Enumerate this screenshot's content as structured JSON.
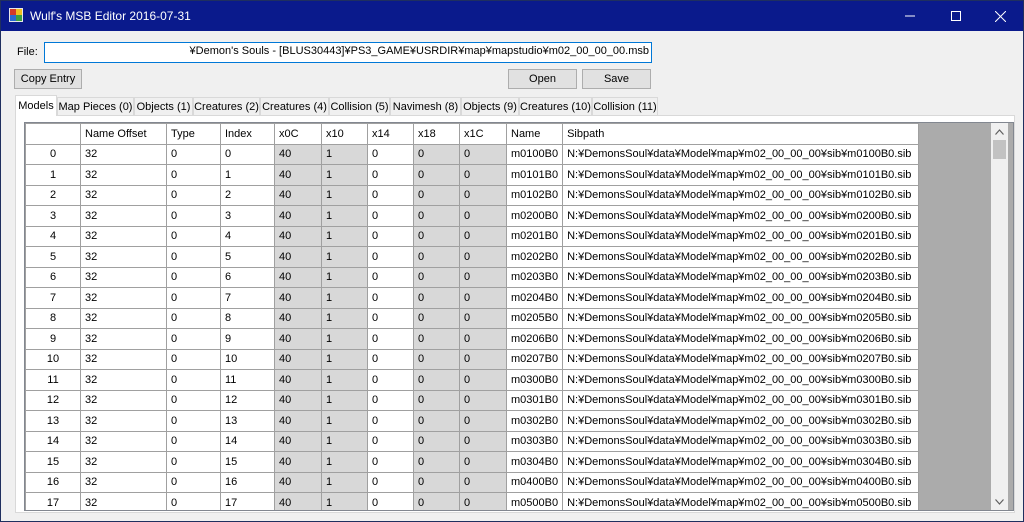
{
  "window": {
    "title": "Wulf's MSB Editor 2016-07-31"
  },
  "file": {
    "label": "File:",
    "path": "¥Demon's Souls - [BLUS30443]¥PS3_GAME¥USRDIR¥map¥mapstudio¥m02_00_00_00.msb"
  },
  "buttons": {
    "copy_entry": "Copy Entry",
    "open": "Open",
    "save": "Save"
  },
  "tabs": [
    "Models",
    "Map Pieces (0)",
    "Objects (1)",
    "Creatures (2)",
    "Creatures (4)",
    "Collision (5)",
    "Navimesh (8)",
    "Objects (9)",
    "Creatures (10)",
    "Collision (11)"
  ],
  "table": {
    "columns": [
      "Name Offset",
      "Type",
      "Index",
      "x0C",
      "x10",
      "x14",
      "x18",
      "x1C",
      "Name",
      "Sibpath"
    ],
    "rows": [
      [
        "0",
        "32",
        "0",
        "0",
        "40",
        "1",
        "0",
        "0",
        "0",
        "m0100B0",
        "N:¥DemonsSoul¥data¥Model¥map¥m02_00_00_00¥sib¥m0100B0.sib"
      ],
      [
        "1",
        "32",
        "0",
        "1",
        "40",
        "1",
        "0",
        "0",
        "0",
        "m0101B0",
        "N:¥DemonsSoul¥data¥Model¥map¥m02_00_00_00¥sib¥m0101B0.sib"
      ],
      [
        "2",
        "32",
        "0",
        "2",
        "40",
        "1",
        "0",
        "0",
        "0",
        "m0102B0",
        "N:¥DemonsSoul¥data¥Model¥map¥m02_00_00_00¥sib¥m0102B0.sib"
      ],
      [
        "3",
        "32",
        "0",
        "3",
        "40",
        "1",
        "0",
        "0",
        "0",
        "m0200B0",
        "N:¥DemonsSoul¥data¥Model¥map¥m02_00_00_00¥sib¥m0200B0.sib"
      ],
      [
        "4",
        "32",
        "0",
        "4",
        "40",
        "1",
        "0",
        "0",
        "0",
        "m0201B0",
        "N:¥DemonsSoul¥data¥Model¥map¥m02_00_00_00¥sib¥m0201B0.sib"
      ],
      [
        "5",
        "32",
        "0",
        "5",
        "40",
        "1",
        "0",
        "0",
        "0",
        "m0202B0",
        "N:¥DemonsSoul¥data¥Model¥map¥m02_00_00_00¥sib¥m0202B0.sib"
      ],
      [
        "6",
        "32",
        "0",
        "6",
        "40",
        "1",
        "0",
        "0",
        "0",
        "m0203B0",
        "N:¥DemonsSoul¥data¥Model¥map¥m02_00_00_00¥sib¥m0203B0.sib"
      ],
      [
        "7",
        "32",
        "0",
        "7",
        "40",
        "1",
        "0",
        "0",
        "0",
        "m0204B0",
        "N:¥DemonsSoul¥data¥Model¥map¥m02_00_00_00¥sib¥m0204B0.sib"
      ],
      [
        "8",
        "32",
        "0",
        "8",
        "40",
        "1",
        "0",
        "0",
        "0",
        "m0205B0",
        "N:¥DemonsSoul¥data¥Model¥map¥m02_00_00_00¥sib¥m0205B0.sib"
      ],
      [
        "9",
        "32",
        "0",
        "9",
        "40",
        "1",
        "0",
        "0",
        "0",
        "m0206B0",
        "N:¥DemonsSoul¥data¥Model¥map¥m02_00_00_00¥sib¥m0206B0.sib"
      ],
      [
        "10",
        "32",
        "0",
        "10",
        "40",
        "1",
        "0",
        "0",
        "0",
        "m0207B0",
        "N:¥DemonsSoul¥data¥Model¥map¥m02_00_00_00¥sib¥m0207B0.sib"
      ],
      [
        "11",
        "32",
        "0",
        "11",
        "40",
        "1",
        "0",
        "0",
        "0",
        "m0300B0",
        "N:¥DemonsSoul¥data¥Model¥map¥m02_00_00_00¥sib¥m0300B0.sib"
      ],
      [
        "12",
        "32",
        "0",
        "12",
        "40",
        "1",
        "0",
        "0",
        "0",
        "m0301B0",
        "N:¥DemonsSoul¥data¥Model¥map¥m02_00_00_00¥sib¥m0301B0.sib"
      ],
      [
        "13",
        "32",
        "0",
        "13",
        "40",
        "1",
        "0",
        "0",
        "0",
        "m0302B0",
        "N:¥DemonsSoul¥data¥Model¥map¥m02_00_00_00¥sib¥m0302B0.sib"
      ],
      [
        "14",
        "32",
        "0",
        "14",
        "40",
        "1",
        "0",
        "0",
        "0",
        "m0303B0",
        "N:¥DemonsSoul¥data¥Model¥map¥m02_00_00_00¥sib¥m0303B0.sib"
      ],
      [
        "15",
        "32",
        "0",
        "15",
        "40",
        "1",
        "0",
        "0",
        "0",
        "m0304B0",
        "N:¥DemonsSoul¥data¥Model¥map¥m02_00_00_00¥sib¥m0304B0.sib"
      ],
      [
        "16",
        "32",
        "0",
        "16",
        "40",
        "1",
        "0",
        "0",
        "0",
        "m0400B0",
        "N:¥DemonsSoul¥data¥Model¥map¥m02_00_00_00¥sib¥m0400B0.sib"
      ],
      [
        "17",
        "32",
        "0",
        "17",
        "40",
        "1",
        "0",
        "0",
        "0",
        "m0500B0",
        "N:¥DemonsSoul¥data¥Model¥map¥m02_00_00_00¥sib¥m0500B0.sib"
      ]
    ]
  },
  "colors": {
    "titlebar": "#0a1a8c",
    "readonly_cell": "#d8d8d8",
    "grid_background": "#ababab"
  },
  "icons": [
    "app-icon",
    "minimize-icon",
    "maximize-icon",
    "close-icon",
    "scroll-up-icon",
    "scroll-down-icon"
  ]
}
